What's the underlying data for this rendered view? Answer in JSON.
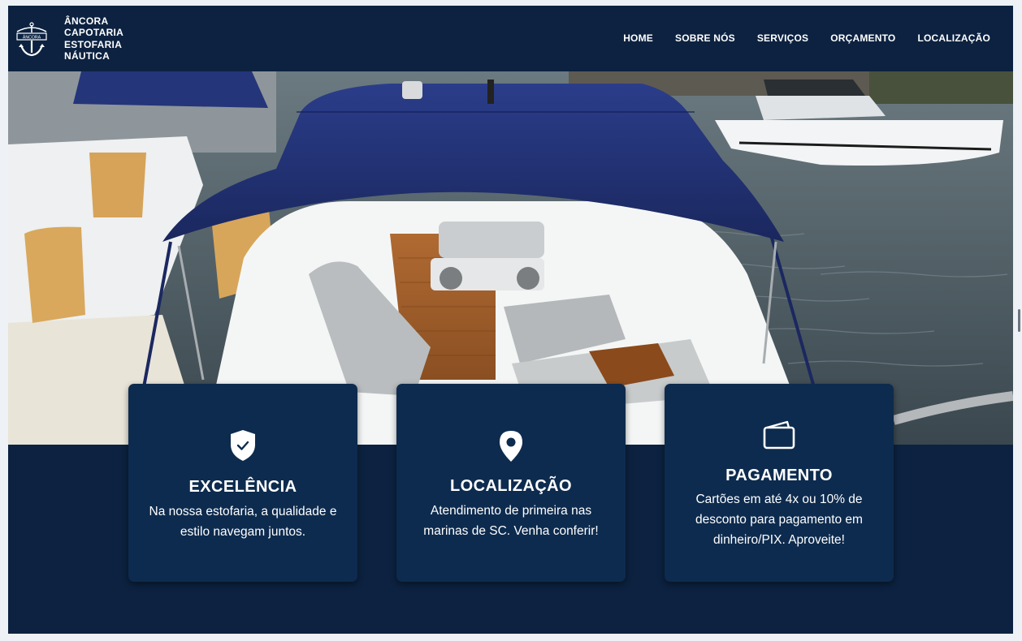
{
  "brand": {
    "logo_label": "ÂNCORA",
    "lines": [
      "ÂNCORA",
      "CAPOTARIA",
      "ESTOFARIA",
      "NÁUTICA"
    ]
  },
  "nav": {
    "items": [
      "HOME",
      "SOBRE NÓS",
      "SERVIÇOS",
      "ORÇAMENTO",
      "LOCALIZAÇÃO"
    ]
  },
  "hero": {
    "icon": "boat-photo"
  },
  "cards": [
    {
      "icon": "shield-check-icon",
      "title": "EXCELÊNCIA",
      "text": "Na nossa estofaria, a qualidade e estilo navegam juntos."
    },
    {
      "icon": "map-pin-icon",
      "title": "LOCALIZAÇÃO",
      "text": "Atendimento de primeira nas marinas de SC. Venha conferir!"
    },
    {
      "icon": "wallet-icon",
      "title": "PAGAMENTO",
      "text": "Cartões em até 4x ou 10% de desconto para pagamento em dinheiro/PIX. Aproveite!"
    }
  ],
  "colors": {
    "navy": "#0c2240",
    "card": "#0d2b4e",
    "canopy": "#1f2f73",
    "water": "#3b4a52"
  }
}
